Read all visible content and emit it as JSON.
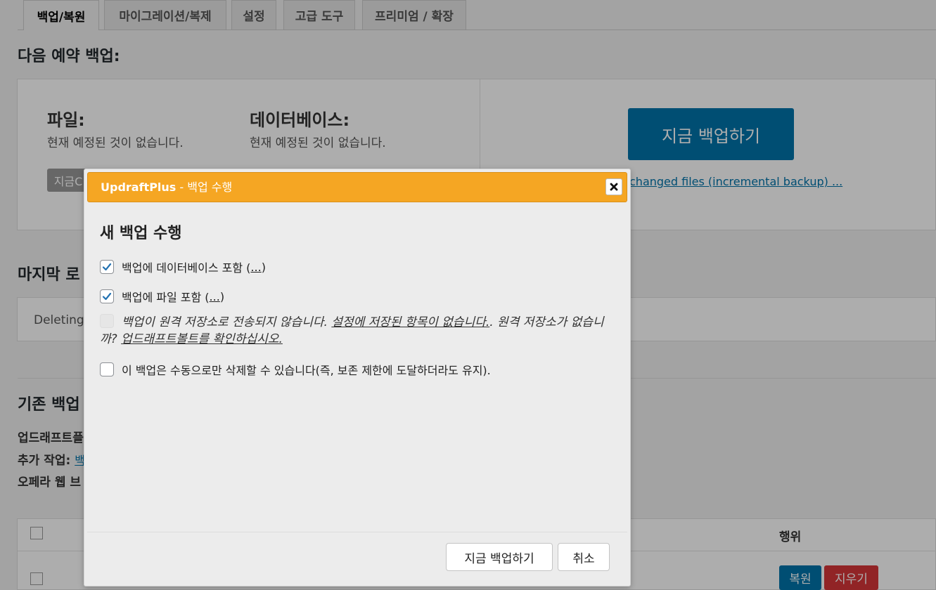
{
  "tabs": [
    "백업/복원",
    "마이그레이션/복제",
    "설정",
    "고급 도구",
    "프리미엄 / 확장"
  ],
  "next_backup": {
    "heading": "다음 예약 백업:",
    "files_label": "파일:",
    "files_status": "현재 예정된 것이 없습니다.",
    "database_label": "데이터베이스:",
    "database_status": "현재 예정된 것이 없습니다.",
    "small_button": "지금C",
    "backup_now_button": "지금 백업하기",
    "incremental_link": "changed files (incremental backup) ..."
  },
  "last_log": {
    "heading": "마지막 로",
    "message": "Deleting"
  },
  "existing_backups": {
    "heading": "기존 백업",
    "line1": "업드래프트플",
    "line2_label": "추가 작업:",
    "line2_link": "백",
    "line3": "오페라 웹 브",
    "action_header": "행위",
    "restore_button": "복원",
    "delete_button": "지우기"
  },
  "dialog": {
    "title_brand": "UpdraftPlus",
    "title_suffix": " - 백업 수행",
    "heading": "새 백업 수행",
    "options": [
      {
        "text": "백업에 데이터베이스 포함 (",
        "link": "...",
        "tail": ")",
        "checked": true
      },
      {
        "text": "백업에 파일 포함 (",
        "link": "...",
        "tail": ")",
        "checked": true
      }
    ],
    "remote_note_1": "백업이 원격 저장소로 전송되지 않습니다. ",
    "remote_note_link_1": "설정에 저장된 항목이 없습니다.",
    "remote_note_2": ". 원격 저장소가 없습니까? ",
    "remote_note_link_2": "업드래프트볼트를 확인하십시오.",
    "manual_delete_option": "이 백업은 수동으로만 삭제할 수 있습니다(즉, 보존 제한에 도달하더라도 유지).",
    "backup_now_button": "지금 백업하기",
    "cancel_button": "취소"
  },
  "colors": {
    "dialog_title_bg": "#f5a623",
    "primary_button": "#0073aa",
    "restore_button": "#0073aa",
    "delete_button": "#d63638"
  },
  "icons": [
    "close-icon",
    "check-icon"
  ]
}
